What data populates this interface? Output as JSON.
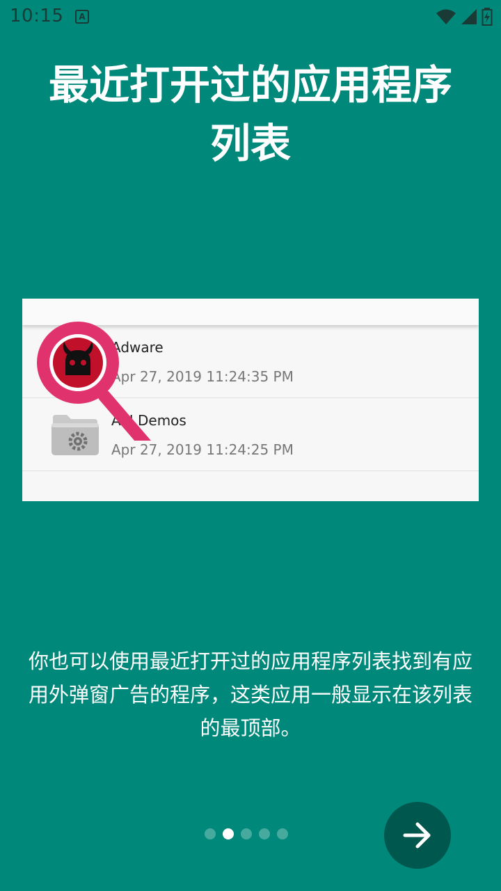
{
  "status_bar": {
    "time": "10:15",
    "app_icon_letter": "A",
    "icons": [
      "wifi-icon",
      "signal-icon",
      "battery-charging-icon"
    ]
  },
  "title": "最近打开过的应用程序列表",
  "preview": {
    "items": [
      {
        "name": "Adware",
        "date": "Apr 27, 2019 11:24:35 PM",
        "icon": "adware-devil-icon"
      },
      {
        "name": "API Demos",
        "date": "Apr 27, 2019 11:24:25 PM",
        "icon": "folder-gear-icon"
      }
    ],
    "highlight": "magnifier-icon"
  },
  "description": "你也可以使用最近打开过的应用程序列表找到有应用外弹窗广告的程序，这类应用一般显示在该列表的最顶部。",
  "pager": {
    "total": 5,
    "active_index": 1
  },
  "colors": {
    "background": "#00897b",
    "next_button": "#00574d",
    "magnifier": "#e0336e",
    "adware": "#c0102a"
  },
  "next_button_icon": "arrow-right-icon"
}
